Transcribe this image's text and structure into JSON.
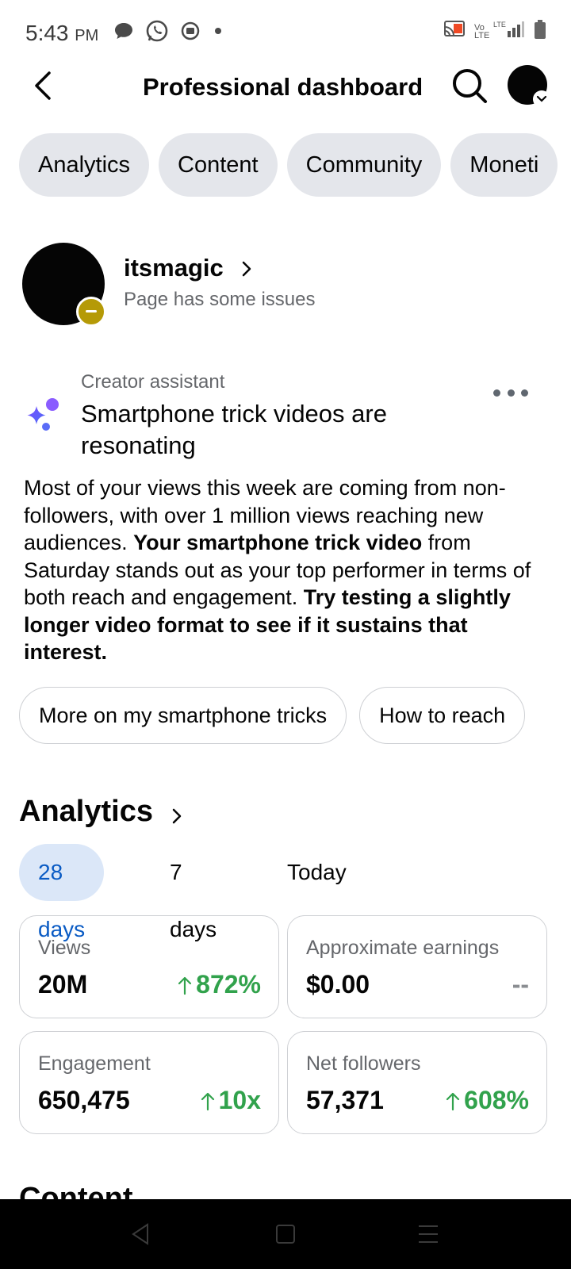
{
  "status_bar": {
    "time": "5:43",
    "ampm": "PM",
    "network_label": "Vo LTE",
    "lte_label": "LTE"
  },
  "header": {
    "title": "Professional dashboard"
  },
  "tabs": [
    "Analytics",
    "Content",
    "Community",
    "Moneti"
  ],
  "page": {
    "name": "itsmagic",
    "status": "Page has some issues"
  },
  "assistant": {
    "label": "Creator assistant",
    "title": "Smartphone trick videos are resonating",
    "body_1": "Most of your views this week are coming from non-followers, with over 1 million views reaching new audiences. ",
    "body_2_bold": "Your smartphone trick video",
    "body_3": " from Saturday stands out as your top performer in terms of both reach and engagement. ",
    "body_4_bold": "Try testing a slightly longer video format to see if it sustains that interest.",
    "chips": [
      "More on my smartphone tricks",
      "How to reach"
    ]
  },
  "analytics": {
    "title": "Analytics",
    "periods": [
      "28 days",
      "7 days",
      "Today"
    ],
    "active_period": "28 days",
    "cards": [
      {
        "label": "Views",
        "value": "20M",
        "change": "872%",
        "trend": "up"
      },
      {
        "label": "Approximate earnings",
        "value": "$0.00",
        "change": "--",
        "trend": "none"
      },
      {
        "label": "Engagement",
        "value": "650,475",
        "change": "10x",
        "trend": "up"
      },
      {
        "label": "Net followers",
        "value": "57,371",
        "change": "608%",
        "trend": "up"
      }
    ]
  },
  "next_section_peek": "Content",
  "colors": {
    "accent_blue": "#0a5bc4",
    "positive_green": "#31a24c",
    "badge_gold": "#b59a07",
    "sparkle_start": "#7b4dff",
    "sparkle_end": "#4a6cf7"
  }
}
